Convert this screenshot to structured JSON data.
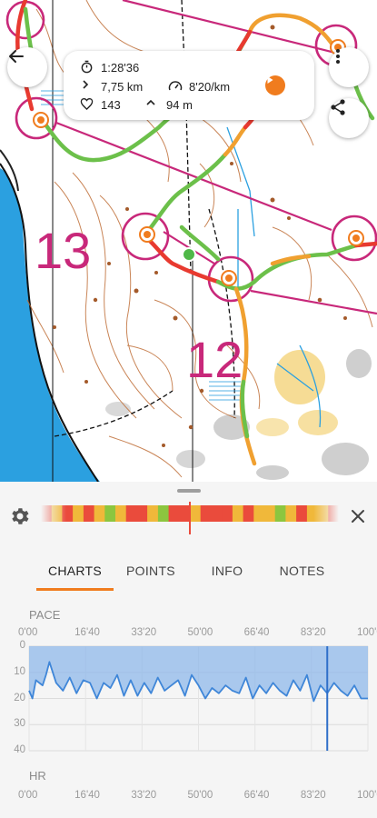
{
  "toolbar": {
    "back_icon": "arrow-left-icon",
    "more_icon": "more-vertical-icon",
    "share_icon": "share-icon"
  },
  "stats": {
    "duration": "1:28'36",
    "distance": "7,75 km",
    "avg_pace": "8'20/km",
    "heart_rate": "143",
    "elevation": "94 m",
    "play_icon": "play-icon"
  },
  "map": {
    "control_labels": [
      "13",
      "12"
    ],
    "control_color": "#c8287a",
    "water_color": "#2ba0e0"
  },
  "panel": {
    "tabs": [
      {
        "label": "CHARTS",
        "active": true
      },
      {
        "label": "POINTS",
        "active": false
      },
      {
        "label": "INFO",
        "active": false
      },
      {
        "label": "NOTES",
        "active": false
      }
    ],
    "accent": "#f07c1e"
  },
  "chart_data": [
    {
      "type": "line",
      "title": "PACE",
      "x_tick_labels": [
        "0'00",
        "16'40",
        "33'20",
        "50'00",
        "66'40",
        "83'20",
        "100'00"
      ],
      "y_tick_labels": [
        "0",
        "10",
        "20",
        "30",
        "40"
      ],
      "ylim": [
        0,
        40
      ],
      "y_inverted": true,
      "x": [
        0,
        1,
        2,
        4,
        5,
        6,
        8,
        10,
        12,
        14,
        16,
        18,
        20,
        22,
        24,
        26,
        28,
        30,
        32,
        34,
        36,
        38,
        40,
        42,
        44,
        46,
        48,
        50,
        52,
        54,
        56,
        58,
        60,
        62,
        64,
        66,
        68,
        70,
        72,
        74,
        76,
        78,
        80,
        82,
        84,
        86,
        88,
        90,
        92,
        94,
        96,
        98,
        100
      ],
      "values": [
        17,
        20,
        13,
        15,
        11,
        6,
        14,
        17,
        12,
        18,
        13,
        14,
        20,
        14,
        16,
        11,
        19,
        13,
        19,
        14,
        18,
        12,
        17,
        15,
        13,
        19,
        11,
        15,
        20,
        16,
        18,
        15,
        17,
        18,
        12,
        20,
        15,
        18,
        14,
        17,
        19,
        13,
        17,
        11,
        21,
        15,
        18,
        14,
        17,
        19,
        15,
        20,
        20
      ],
      "cursor_x": 88,
      "line_color": "#3f86d8",
      "fill_color": "#8fb8ea",
      "grid": true
    },
    {
      "type": "line",
      "title": "HR",
      "x_tick_labels": [
        "0'00",
        "16'40",
        "33'20",
        "50'00",
        "66'40",
        "83'20",
        "100'00"
      ]
    }
  ]
}
